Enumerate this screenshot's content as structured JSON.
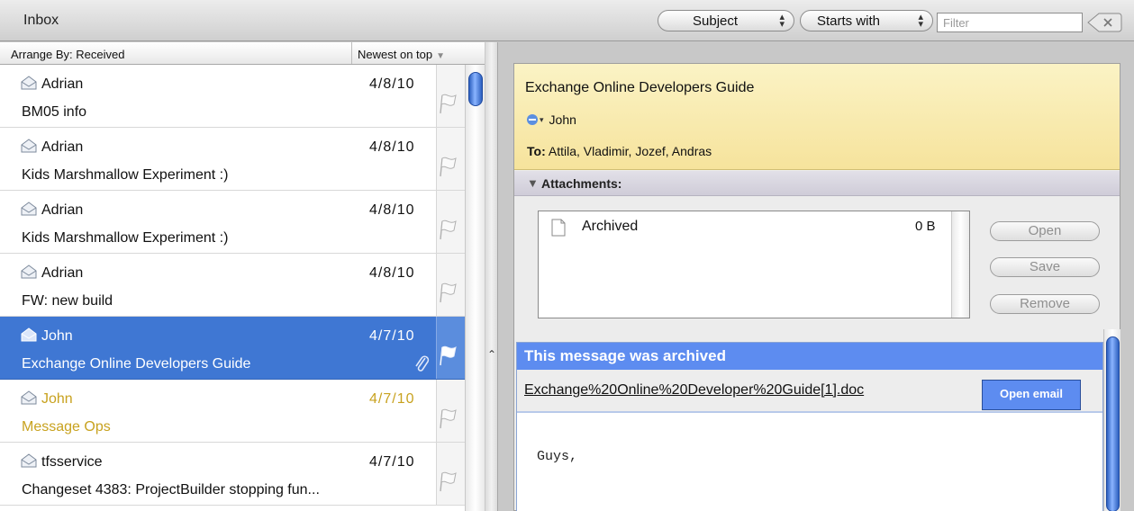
{
  "app": {
    "folder_title": "Inbox"
  },
  "search": {
    "field_select": "Subject",
    "match_select": "Starts with",
    "filter_placeholder": "Filter",
    "filter_value": ""
  },
  "list": {
    "arrange_label": "Arrange By: Received",
    "sort_label": "Newest on top",
    "messages": [
      {
        "sender": "Adrian",
        "date": "4/8/10",
        "subject": "BM05 info",
        "state": "read"
      },
      {
        "sender": "Adrian",
        "date": "4/8/10",
        "subject": "Kids Marshmallow Experiment :)",
        "state": "read"
      },
      {
        "sender": "Adrian",
        "date": "4/8/10",
        "subject": "Kids Marshmallow Experiment :)",
        "state": "read"
      },
      {
        "sender": "Adrian",
        "date": "4/8/10",
        "subject": "FW: new build",
        "state": "read"
      },
      {
        "sender": "John",
        "date": "4/7/10",
        "subject": "Exchange Online Developers Guide",
        "state": "selected",
        "has_attachment": true
      },
      {
        "sender": "John",
        "date": "4/7/10",
        "subject": "Message Ops",
        "state": "unread"
      },
      {
        "sender": "tfsservice",
        "date": "4/7/10",
        "subject": "Changeset 4383: ProjectBuilder stopping fun...",
        "state": "read"
      }
    ]
  },
  "reading": {
    "subject": "Exchange Online Developers Guide",
    "from": "John",
    "to_label": "To:",
    "to_value": "Attila, Vladimir, Jozef, Andras",
    "attachments_label": "Attachments:",
    "attachment": {
      "name": "Archived",
      "size": "0 B"
    },
    "buttons": {
      "open": "Open",
      "save": "Save",
      "remove": "Remove"
    },
    "archived_banner": "This message was archived",
    "archived_link": "Exchange%20Online%20Developer%20Guide[1].doc",
    "open_email_label": "Open email",
    "body_text": "Guys,"
  },
  "colors": {
    "selection": "#3f77d3",
    "unread_text": "#c8a21f",
    "header_bg": "#f6e39c",
    "archived_banner": "#5d8cf0"
  },
  "icons": {
    "envelope": "envelope-icon",
    "flag": "flag-icon",
    "attachment": "paperclip-icon",
    "file": "file-icon",
    "clear": "clear-x-icon"
  }
}
